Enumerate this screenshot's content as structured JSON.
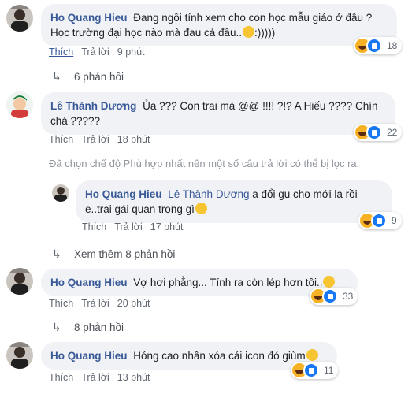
{
  "comments": [
    {
      "author": "Ho Quang Hieu",
      "text": "Đang ngồi tính xem cho con học mẫu giáo ở đâu ? Học trường đại học nào mà đau cả đầu..",
      "tail": ":)))))",
      "like": "Thích",
      "reply": "Trả lời",
      "time": "9 phút",
      "reactions": "18",
      "replies": "6 phản hồi"
    },
    {
      "author": "Lê Thành Dương",
      "text": "Ủa ??? Con trai mà @@ !!!! ?!? A Hiếu ???? Chín chá ?????",
      "like": "Thích",
      "reply": "Trả lời",
      "time": "18 phút",
      "reactions": "22"
    },
    {
      "author": "Ho Quang Hieu",
      "tagged": "Lê Thành Dương",
      "text": "a đổi gu cho mới lạ rồi e..trai gái quan trọng gì",
      "like": "Thích",
      "reply": "Trả lời",
      "time": "17 phút",
      "reactions": "9",
      "replies": "Xem thêm 8 phản hồi"
    },
    {
      "author": "Ho Quang Hieu",
      "text": "Vợ hơi phẳng... Tính ra còn lép hơn tôi..",
      "like": "Thích",
      "reply": "Trả lời",
      "time": "20 phút",
      "reactions": "33",
      "replies": "8 phản hồi"
    },
    {
      "author": "Ho Quang Hieu",
      "text": "Hóng cao nhân xóa cái icon đó giùm",
      "like": "Thích",
      "reply": "Trả lời",
      "time": "13 phút",
      "reactions": "11"
    }
  ],
  "notice": "Đã chọn chế độ Phù hợp nhất nên một số câu trả lời có thể bị lọc ra.",
  "colors": {
    "link": "#385898",
    "bubble": "#f0f2f5",
    "muted": "#606770"
  }
}
